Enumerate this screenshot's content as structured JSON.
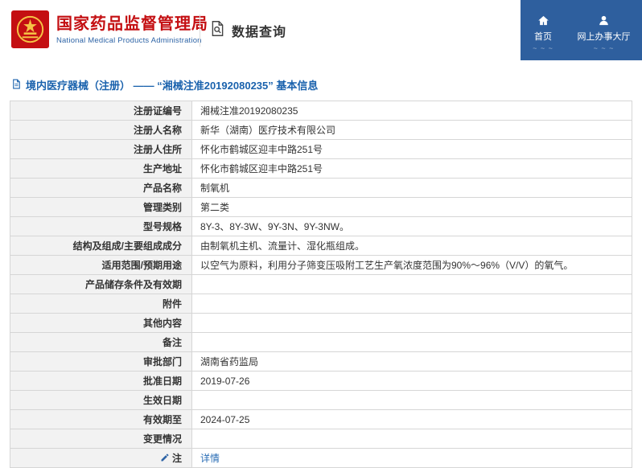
{
  "header": {
    "org_name_cn": "国家药品监督管理局",
    "org_name_en": "National Medical Products Administration",
    "section_title": "数据查询",
    "nav_home": "首页",
    "nav_service_hall": "网上办事大厅"
  },
  "page": {
    "title": "境内医疗器械（注册） ——  “湘械注准20192080235” 基本信息"
  },
  "colors": {
    "brand_red": "#c40f12",
    "brand_blue": "#2e64a6",
    "panel_blue": "#2e5f9e",
    "title_blue": "#1a62ad",
    "link_blue": "#2a6db5",
    "label_bg": "#f2f2f2",
    "border_gray": "#d6d6d6"
  },
  "icons": {
    "brand": "national-emblem",
    "section": "document-search-icon",
    "nav_home": "home-icon",
    "nav_service_hall": "person-icon",
    "page_title": "document-icon",
    "note_row": "edit-icon"
  },
  "table": {
    "rows": [
      {
        "label": "注册证编号",
        "value": "湘械注准20192080235"
      },
      {
        "label": "注册人名称",
        "value": "新华（湖南）医疗技术有限公司"
      },
      {
        "label": "注册人住所",
        "value": "怀化市鹤城区迎丰中路251号"
      },
      {
        "label": "生产地址",
        "value": "怀化市鹤城区迎丰中路251号"
      },
      {
        "label": "产品名称",
        "value": "制氧机"
      },
      {
        "label": "管理类别",
        "value": "第二类"
      },
      {
        "label": "型号规格",
        "value": "8Y-3、8Y-3W、9Y-3N、9Y-3NW。"
      },
      {
        "label": "结构及组成/主要组成成分",
        "value": "由制氧机主机、流量计、湿化瓶组成。"
      },
      {
        "label": "适用范围/预期用途",
        "value": "以空气为原料，利用分子筛变压吸附工艺生产氧浓度范围为90%～96%（V/V）的氧气。"
      },
      {
        "label": "产品储存条件及有效期",
        "value": ""
      },
      {
        "label": "附件",
        "value": ""
      },
      {
        "label": "其他内容",
        "value": ""
      },
      {
        "label": "备注",
        "value": ""
      },
      {
        "label": "审批部门",
        "value": "湖南省药监局"
      },
      {
        "label": "批准日期",
        "value": "2019-07-26"
      },
      {
        "label": "生效日期",
        "value": ""
      },
      {
        "label": "有效期至",
        "value": "2024-07-25"
      },
      {
        "label": "变更情况",
        "value": ""
      },
      {
        "label": "注",
        "value": "详情",
        "link": true,
        "label_icon": true
      }
    ]
  }
}
